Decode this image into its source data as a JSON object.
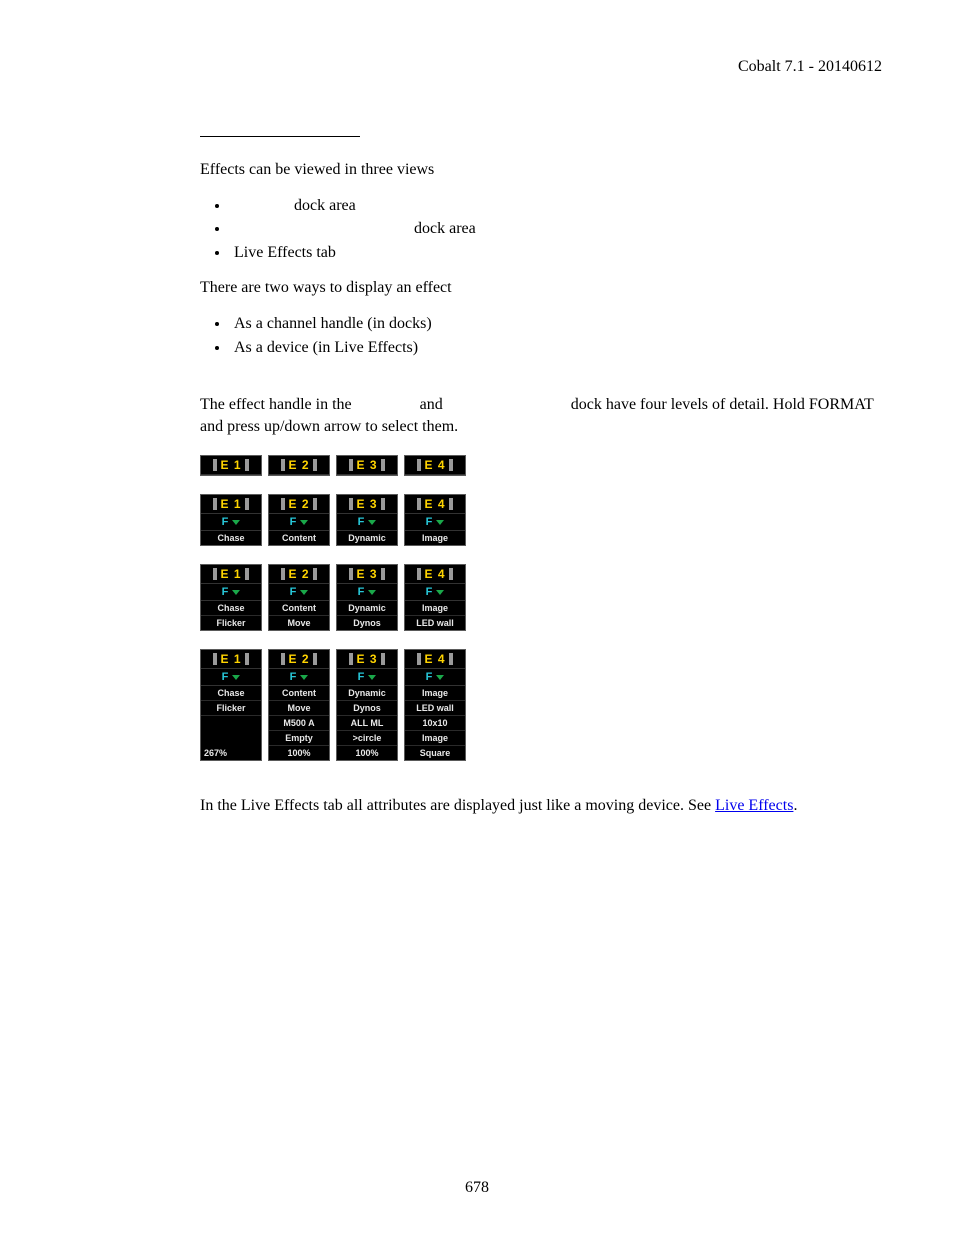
{
  "header": {
    "version": "Cobalt 7.1 - 20140612"
  },
  "intro": {
    "p1": "Effects can be viewed in three views",
    "bullets_a": [
      {
        "prefix_gap": "li-gap",
        "text": "dock area"
      },
      {
        "prefix_gap": "li-gap-wide",
        "text": "dock area"
      },
      {
        "prefix_gap": "",
        "text": "Live Effects tab"
      }
    ],
    "p2": "There are two ways to display an effect",
    "bullets_b": [
      "As a channel handle (in docks)",
      "As a device (in Live Effects)"
    ]
  },
  "detail": {
    "sentence": {
      "s1": "The effect handle in the",
      "s2": "and",
      "s3": "dock have four levels of detail. Hold FORMAT and press up/down arrow to select them."
    }
  },
  "fx": {
    "level1": [
      {
        "e": "E 1"
      },
      {
        "e": "E 2"
      },
      {
        "e": "E 3"
      },
      {
        "e": "E 4"
      }
    ],
    "level2": [
      {
        "e": "E 1",
        "t": "Chase"
      },
      {
        "e": "E 2",
        "t": "Content"
      },
      {
        "e": "E 3",
        "t": "Dynamic"
      },
      {
        "e": "E 4",
        "t": "Image"
      }
    ],
    "level3": [
      {
        "e": "E 1",
        "r": [
          "Chase",
          "Flicker"
        ]
      },
      {
        "e": "E 2",
        "r": [
          "Content",
          "Move"
        ]
      },
      {
        "e": "E 3",
        "r": [
          "Dynamic",
          "Dynos"
        ]
      },
      {
        "e": "E 4",
        "r": [
          "Image",
          "LED wall"
        ]
      }
    ],
    "level4": [
      {
        "e": "E 1",
        "r": [
          "Chase",
          "Flicker"
        ],
        "foot": "267%"
      },
      {
        "e": "E 2",
        "r": [
          "Content",
          "Move",
          "M500 A",
          "Empty",
          "100%"
        ]
      },
      {
        "e": "E 3",
        "r": [
          "Dynamic",
          "Dynos",
          "ALL ML",
          ">circle",
          "100%"
        ]
      },
      {
        "e": "E 4",
        "r": [
          "Image",
          "LED wall",
          "10x10",
          "Image",
          "Square"
        ]
      }
    ]
  },
  "closing": {
    "text_before": "In the Live Effects tab all attributes are displayed just like a moving device. See ",
    "link": "Live Effects",
    "text_after": "."
  },
  "page_number": "678"
}
